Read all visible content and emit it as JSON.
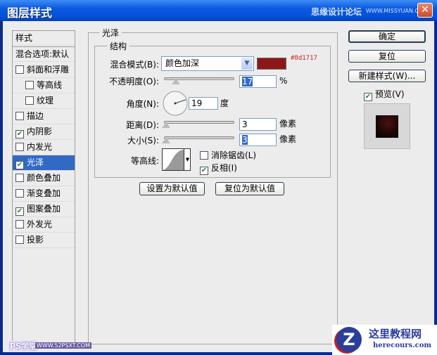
{
  "window": {
    "title": "图层样式",
    "watermark_top": "思缘设计论坛",
    "watermark_top_url": "WWW.MISSYUAN.COM",
    "close": "✕"
  },
  "sidebar": {
    "header": "样式",
    "blend_options": "混合选项:默认",
    "items": [
      {
        "label": "斜面和浮雕",
        "checked": false,
        "indent": false
      },
      {
        "label": "等高线",
        "checked": false,
        "indent": true
      },
      {
        "label": "纹理",
        "checked": false,
        "indent": true
      },
      {
        "label": "描边",
        "checked": false,
        "indent": false
      },
      {
        "label": "内阴影",
        "checked": true,
        "indent": false
      },
      {
        "label": "内发光",
        "checked": false,
        "indent": false
      },
      {
        "label": "光泽",
        "checked": true,
        "indent": false,
        "selected": true
      },
      {
        "label": "颜色叠加",
        "checked": false,
        "indent": false
      },
      {
        "label": "渐变叠加",
        "checked": false,
        "indent": false
      },
      {
        "label": "图案叠加",
        "checked": true,
        "indent": false
      },
      {
        "label": "外发光",
        "checked": false,
        "indent": false
      },
      {
        "label": "投影",
        "checked": false,
        "indent": false
      }
    ]
  },
  "satin": {
    "group_title": "光泽",
    "structure_title": "结构",
    "blend_mode_label": "混合模式(B):",
    "blend_mode_value": "颜色加深",
    "color": "#8d1717",
    "color_annotation": "#8d1717",
    "opacity_label": "不透明度(O):",
    "opacity_value": "17",
    "opacity_unit": "%",
    "opacity_fraction": 0.17,
    "angle_label": "角度(N):",
    "angle_value": "19",
    "angle_unit": "度",
    "distance_label": "距离(D):",
    "distance_value": "3",
    "distance_unit": "像素",
    "size_label": "大小(S):",
    "size_value": "3",
    "size_unit": "像素",
    "contour_label": "等高线:",
    "antialias_label": "消除锯齿(L)",
    "antialias_checked": false,
    "invert_label": "反相(I)",
    "invert_checked": true,
    "set_default": "设置为默认值",
    "reset_default": "复位为默认值"
  },
  "actions": {
    "ok": "确定",
    "reset": "复位",
    "new_style": "新建样式(W)...",
    "preview_label": "预览(V)",
    "preview_checked": true
  },
  "watermarks": {
    "bottom_left": "PS学堂",
    "bottom_left_url": "WWW.52PSXT.COM",
    "bottom_right": "这里教程网",
    "bottom_right_url": "herecours.com"
  }
}
